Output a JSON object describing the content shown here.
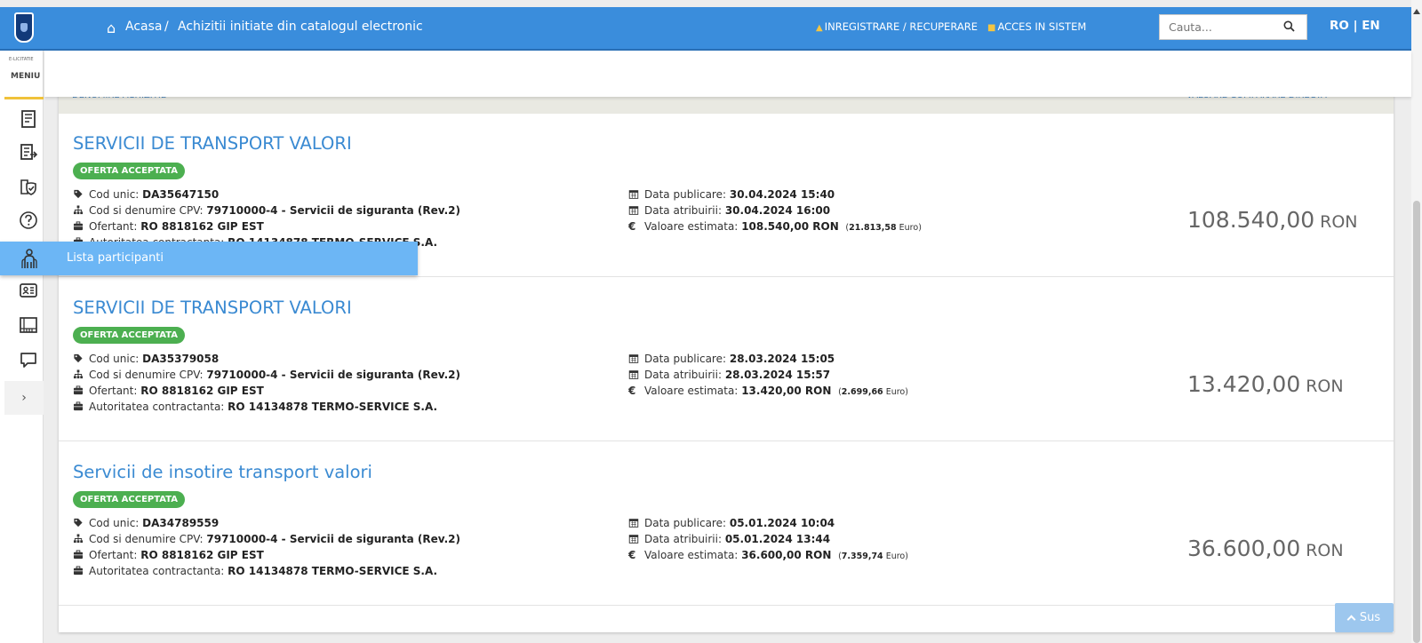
{
  "header": {
    "breadcrumb_home": "Acasa",
    "breadcrumb_sep": "/",
    "breadcrumb_page": "Achizitii initiate din catalogul electronic",
    "register_link": "INREGISTRARE / RECUPERARE",
    "login_link": "ACCES IN SISTEM",
    "search_placeholder": "Cauta...",
    "language": "RO | EN",
    "bar_color": "#3a8ddc"
  },
  "sidebar": {
    "brand_small": "E-LICITATIE",
    "menu_label": "MENIU",
    "expand_label": "›",
    "icons": [
      "document-icon",
      "document-export-icon",
      "shield-check-icon",
      "help-icon",
      "participants-icon",
      "contact-card-icon",
      "catalog-icon",
      "chat-icon"
    ]
  },
  "tooltip": {
    "label": "Lista participanti"
  },
  "table": {
    "col_name": "DENUMIRE ACHIZITIE",
    "col_value": "VALOARE COMPARARE DIRECTA",
    "labels": {
      "cod_unic": "Cod unic:",
      "cpv": "Cod si denumire CPV:",
      "ofertant": "Ofertant:",
      "autoritate": "Autoritatea contractanta:",
      "data_publicare": "Data publicare:",
      "data_atribuirii": "Data atribuirii:",
      "valoare_estimata": "Valoare estimata:",
      "euro_symbol": "€",
      "euro_word": "Euro"
    },
    "rows": [
      {
        "title": "SERVICII DE TRANSPORT VALORI",
        "status": "OFERTA ACCEPTATA",
        "cod_unic": "DA35647150",
        "cpv": "79710000-4 - Servicii de siguranta (Rev.2)",
        "ofertant": "RO 8818162 GIP EST",
        "autoritate": "RO 14134878 TERMO-SERVICE S.A.",
        "data_publicare": "30.04.2024 15:40",
        "data_atribuirii": "30.04.2024 16:00",
        "valoare_estimata": "108.540,00  RON",
        "valoare_euro": "21.813,58",
        "amount": "108.540,00",
        "currency": "RON"
      },
      {
        "title": "SERVICII DE TRANSPORT VALORI",
        "status": "OFERTA ACCEPTATA",
        "cod_unic": "DA35379058",
        "cpv": "79710000-4 - Servicii de siguranta (Rev.2)",
        "ofertant": "RO 8818162 GIP EST",
        "autoritate": "RO 14134878 TERMO-SERVICE S.A.",
        "data_publicare": "28.03.2024 15:05",
        "data_atribuirii": "28.03.2024 15:57",
        "valoare_estimata": "13.420,00  RON",
        "valoare_euro": "2.699,66",
        "amount": "13.420,00",
        "currency": "RON"
      },
      {
        "title": "Servicii de insotire transport valori",
        "status": "OFERTA ACCEPTATA",
        "cod_unic": "DA34789559",
        "cpv": "79710000-4 - Servicii de siguranta (Rev.2)",
        "ofertant": "RO 8818162 GIP EST",
        "autoritate": "RO 14134878 TERMO-SERVICE S.A.",
        "data_publicare": "05.01.2024 10:04",
        "data_atribuirii": "05.01.2024 13:44",
        "valoare_estimata": "36.600,00  RON",
        "valoare_euro": "7.359,74",
        "amount": "36.600,00",
        "currency": "RON"
      }
    ]
  },
  "scroll_top_button": "Sus"
}
